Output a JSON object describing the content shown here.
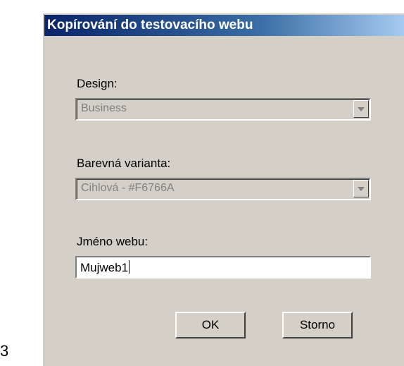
{
  "page_number": "3",
  "dialog": {
    "title": "Kopírování do testovacího webu",
    "design": {
      "label": "Design:",
      "value": "Business"
    },
    "color_variant": {
      "label": "Barevná varianta:",
      "value": "Cihlová - #F6766A"
    },
    "web_name": {
      "label": "Jméno webu:",
      "value": "Mujweb1"
    },
    "buttons": {
      "ok": "OK",
      "cancel": "Storno"
    }
  }
}
